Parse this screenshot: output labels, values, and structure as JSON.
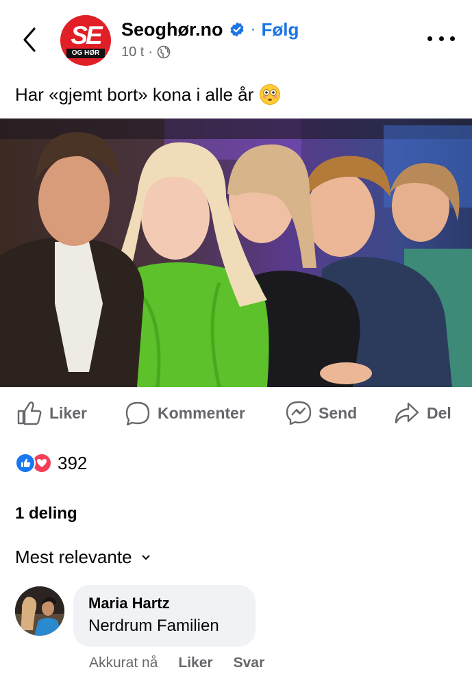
{
  "post": {
    "page_name": "Seoghør.no",
    "follow_label": "Følg",
    "time_ago": "10 t",
    "meta_sep": "·",
    "logo_top": "SE",
    "logo_bottom": "OG HØR",
    "caption": "Har «gjemt bort» kona i alle år"
  },
  "actions": {
    "like": "Liker",
    "comment": "Kommenter",
    "send": "Send",
    "share": "Del"
  },
  "stats": {
    "reaction_count": "392",
    "shares": "1 deling"
  },
  "comments_section": {
    "sort_label": "Mest relevante"
  },
  "comment": {
    "author": "Maria Hartz",
    "text": "Nerdrum Familien",
    "time": "Akkurat nå",
    "like_label": "Liker",
    "reply_label": "Svar"
  },
  "colors": {
    "brand_blue": "#1b74e4",
    "secondary_text": "#65676b",
    "like_blue": "#1877f2",
    "love_red": "#f33e58",
    "logo_red": "#e11f26"
  },
  "icons": [
    "back-icon",
    "verified-icon",
    "globe-icon",
    "more-icon",
    "flushed-face-icon",
    "like-icon",
    "comment-icon",
    "messenger-icon",
    "share-icon",
    "chevron-down-icon"
  ]
}
